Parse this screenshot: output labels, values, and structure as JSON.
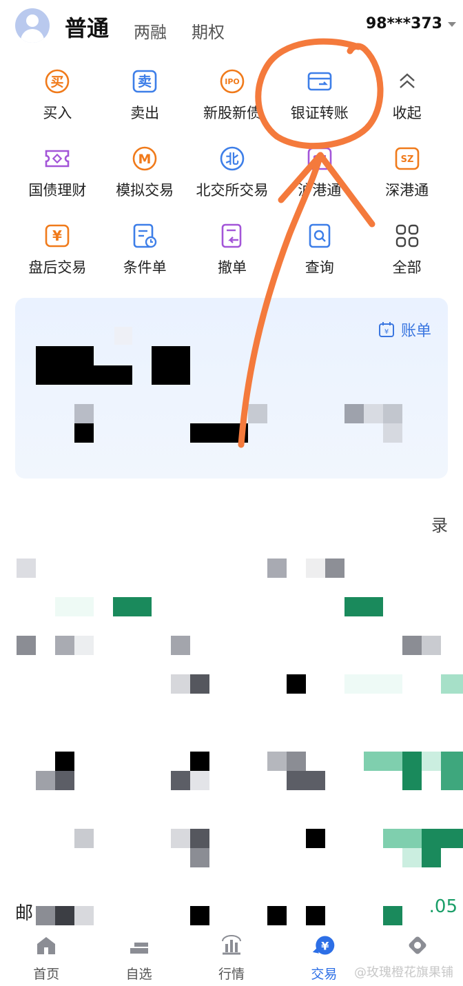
{
  "header": {
    "tab_active": "普通",
    "tab_margin": "两融",
    "tab_options": "期权",
    "account": "98***373"
  },
  "functions": [
    {
      "label": "买入",
      "icon": "buy-icon",
      "glyph": "买",
      "color": "#f07a1a"
    },
    {
      "label": "卖出",
      "icon": "sell-icon",
      "glyph": "卖",
      "color": "#3d7ee8"
    },
    {
      "label": "新股新债",
      "icon": "ipo-icon",
      "glyph": "IPO",
      "color": "#f07a1a"
    },
    {
      "label": "银证转账",
      "icon": "bank-transfer-icon",
      "glyph": "",
      "color": "#3d7ee8"
    },
    {
      "label": "收起",
      "icon": "chevron-up-icon",
      "glyph": "",
      "color": "#555555"
    },
    {
      "label": "国债理财",
      "icon": "bond-ticket-icon",
      "glyph": "",
      "color": "#a355d8"
    },
    {
      "label": "模拟交易",
      "icon": "simulation-icon",
      "glyph": "M",
      "color": "#f07a1a"
    },
    {
      "label": "北交所交易",
      "icon": "beijing-exchange-icon",
      "glyph": "北",
      "color": "#3d7ee8"
    },
    {
      "label": "沪港通",
      "icon": "sh-connect-icon",
      "glyph": "SH",
      "color": "#a355d8"
    },
    {
      "label": "深港通",
      "icon": "sz-connect-icon",
      "glyph": "SZ",
      "color": "#f07a1a"
    },
    {
      "label": "盘后交易",
      "icon": "after-hours-icon",
      "glyph": "¥",
      "color": "#f07a1a"
    },
    {
      "label": "条件单",
      "icon": "conditional-order-icon",
      "glyph": "",
      "color": "#3d7ee8"
    },
    {
      "label": "撤单",
      "icon": "cancel-order-icon",
      "glyph": "",
      "color": "#a355d8"
    },
    {
      "label": "查询",
      "icon": "query-icon",
      "glyph": "",
      "color": "#3d7ee8"
    },
    {
      "label": "全部",
      "icon": "all-grid-icon",
      "glyph": "",
      "color": "#444444"
    }
  ],
  "card": {
    "bill_label": "账单",
    "bill_icon": "calendar-icon"
  },
  "list": {
    "record_text": "录",
    "mail_text": "邮",
    "value_text": ".05"
  },
  "nav": [
    {
      "label": "首页",
      "icon": "home-icon",
      "active": false
    },
    {
      "label": "自选",
      "icon": "watchlist-icon",
      "active": false
    },
    {
      "label": "行情",
      "icon": "market-icon",
      "active": false
    },
    {
      "label": "交易",
      "icon": "trade-yen-icon",
      "active": true
    },
    {
      "label": "",
      "icon": "profile-icon",
      "active": false
    }
  ],
  "watermark": "@玫瑰橙花旗果铺",
  "colors": {
    "accent_blue": "#2d6fe6",
    "annotation_orange": "#f47a3c",
    "green": "#1a9e68"
  }
}
